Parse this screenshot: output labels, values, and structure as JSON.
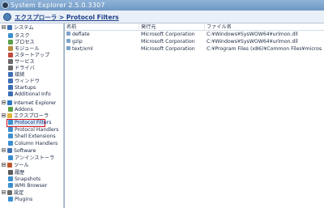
{
  "window": {
    "title": "System Explorer 2.5.0.3307"
  },
  "breadcrumb": {
    "text": "エクスプローラ > Protocol Filters"
  },
  "sidebar": {
    "items": [
      {
        "label": "システム",
        "icon": "system-icon",
        "color": "#3c6fb5"
      },
      {
        "label": "タスク",
        "icon": "task-icon",
        "color": "#3c8fd0"
      },
      {
        "label": "プロセス",
        "icon": "process-icon",
        "color": "#5aa04a"
      },
      {
        "label": "モジュール",
        "icon": "module-icon",
        "color": "#b58d3c"
      },
      {
        "label": "スタートアップ",
        "icon": "startup-icon",
        "color": "#c04a3c"
      },
      {
        "label": "サービス",
        "icon": "service-icon",
        "color": "#6a6a6a"
      },
      {
        "label": "ドライバ",
        "icon": "driver-icon",
        "color": "#6a6a6a"
      },
      {
        "label": "接続",
        "icon": "connection-icon",
        "color": "#3c6fb5"
      },
      {
        "label": "ウィンドウ",
        "icon": "window-icon",
        "color": "#3c6fb5"
      },
      {
        "label": "Startups",
        "icon": "startups-icon",
        "color": "#3c6fb5"
      },
      {
        "label": "Additional Info",
        "icon": "info-icon",
        "color": "#3c6fb5"
      },
      {
        "label": "Internet Explorer",
        "icon": "ie-icon",
        "color": "#2f78c6"
      },
      {
        "label": "Addons",
        "icon": "addons-icon",
        "color": "#5aa04a"
      },
      {
        "label": "エクスプローラ",
        "icon": "explorer-icon",
        "color": "#e0b33a"
      },
      {
        "label": "Protocol Filters",
        "icon": "filter-icon",
        "color": "#3c8fd0"
      },
      {
        "label": "Protocol Handlers",
        "icon": "handler-icon",
        "color": "#3c8fd0"
      },
      {
        "label": "Shell Extensions",
        "icon": "shell-icon",
        "color": "#3c8fd0"
      },
      {
        "label": "Column Handlers",
        "icon": "column-icon",
        "color": "#3c8fd0"
      },
      {
        "label": "Software",
        "icon": "software-icon",
        "color": "#3c6fb5"
      },
      {
        "label": "アンインストーラ",
        "icon": "uninstall-icon",
        "color": "#3c8fd0"
      },
      {
        "label": "ツール",
        "icon": "tools-icon",
        "color": "#c0562f"
      },
      {
        "label": "履歴",
        "icon": "history-icon",
        "color": "#5a5a5a"
      },
      {
        "label": "Snapshots",
        "icon": "snapshot-icon",
        "color": "#3c8fd0"
      },
      {
        "label": "WMI Browser",
        "icon": "wmi-icon",
        "color": "#3c8fd0"
      },
      {
        "label": "設定",
        "icon": "settings-icon",
        "color": "#6a6a6a"
      },
      {
        "label": "Plugins",
        "icon": "plugin-icon",
        "color": "#3c8fd0"
      }
    ]
  },
  "list": {
    "columns": [
      "名前",
      "発行元",
      "ファイル名"
    ],
    "rows": [
      {
        "name": "deflate",
        "publisher": "Microsoft Corporation",
        "file": "C:¥Windows¥SysWOW64¥urlmon.dll"
      },
      {
        "name": "gzip",
        "publisher": "Microsoft Corporation",
        "file": "C:¥Windows¥SysWOW64¥urlmon.dll"
      },
      {
        "name": "text/xml",
        "publisher": "Microsoft Corporation",
        "file": "C:¥Program Files (x86)¥Common Files¥micros..."
      }
    ]
  }
}
